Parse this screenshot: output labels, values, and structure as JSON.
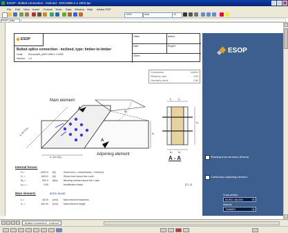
{
  "window": {
    "title": "ESOP - Bolted connection - Inclined - ENV1995-1-1 2004 tpx"
  },
  "menu": [
    "File",
    "Edit",
    "View",
    "Insert",
    "Format",
    "Tools",
    "Data",
    "Window",
    "Help",
    "Adobe PDF"
  ],
  "toolbar": {
    "font": "Arial",
    "size": "10"
  },
  "formula": {
    "cell": "ESOP_Data"
  },
  "header": {
    "logo": "ESOP",
    "title": "Bolted splice connection - inclined, type: timber-to-timber",
    "code_label": "Code:",
    "code_value": "Eurocode5, prEN 1995-1-1:2003",
    "version_label": "Version:",
    "version_value": "1.0",
    "office": "Office",
    "author": "Author",
    "date": "Date",
    "project": "Project",
    "client": "Client"
  },
  "brand": {
    "logo": "ESOP",
    "option1": "Reading from structure (Robot)",
    "option2": "Continuous adjoining element",
    "cross_section_label": "Cross-section",
    "cross_section_value": "BORD 45x250",
    "material_label": "Material",
    "material_value": "TIMBER"
  },
  "results": [
    {
      "label": "Correctness",
      "value": "verified"
    },
    {
      "label": "Efficiency ratio",
      "value": "0.63"
    },
    {
      "label": "Geometry check",
      "value": "0.86"
    }
  ],
  "drawing": {
    "main_element": "Main element",
    "adjoining_element": "Adjoining element",
    "section_label": "A - A",
    "section_marker": "A",
    "alpha_label": "a",
    "dim_a1": "a₁ (m-1)*p₁",
    "dim_a1b": "a'₁ (m-1)*p₁",
    "dim_t1": "t₁",
    "dim_t2": "t₂",
    "dim_b1": "b₁",
    "dim_b2": "b₂",
    "dim_h1": "h₁",
    "dim_h2": "h₂"
  },
  "forces": {
    "heading": "Internal forces:",
    "rows": [
      {
        "sym": "N  =",
        "val": "-4000.0",
        "unit": "[N]",
        "desc": "Axial force (- compression, + tension)"
      },
      {
        "sym": "Vᵧ =",
        "val": "1000.0",
        "unit": "[N]",
        "desc": "Shear force about the z axis"
      },
      {
        "sym": "Mᵧ =",
        "val": "500.0",
        "unit": "[Nm]",
        "desc": "Bending moment about the z axis"
      },
      {
        "sym": "kₘₒₑ =",
        "val": "0.80",
        "unit": "",
        "desc": "Modification factor"
      }
    ],
    "ref": "[2.1.3]"
  },
  "main_element": {
    "heading": "Main element:",
    "section": "BORD 45x250",
    "rows": [
      {
        "sym": "t₁ =",
        "val": "45.00",
        "unit": "[mm]",
        "desc": "Main element thickness"
      },
      {
        "sym": "h₁ =",
        "val": "250.00",
        "unit": "[mm]",
        "desc": "Main element height"
      }
    ]
  },
  "tabs": [
    "Bolted connection - inclined"
  ],
  "colors": {
    "brand": "#3c5f8f",
    "titlebar": "#0a246a",
    "ok": "#2a8a2a"
  }
}
